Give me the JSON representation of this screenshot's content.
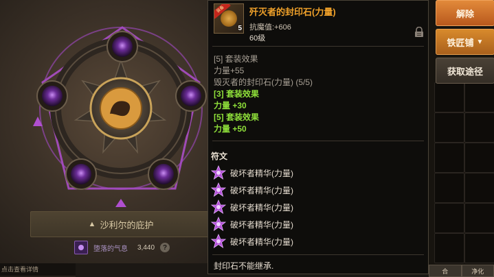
{
  "item": {
    "title": "歼灭者的封印石(力量)",
    "tag": "装备",
    "count": "5",
    "stat": "抗魔值:+606",
    "level": "60级"
  },
  "set_effects": [
    {
      "text": "[5] 套装效果",
      "style": "grey"
    },
    {
      "text": "力量+55",
      "style": "grey"
    },
    {
      "text": "毁灭者的封印石(力量) (5/5)",
      "style": "grey"
    },
    {
      "text": "[3] 套装效果",
      "style": "green"
    },
    {
      "text": "力量 +30",
      "style": "green"
    },
    {
      "text": "[5] 套装效果",
      "style": "green"
    },
    {
      "text": "力量 +50",
      "style": "green"
    }
  ],
  "runes": {
    "header": "符文",
    "items": [
      "破坏者精华(力量)",
      "破坏者精华(力量)",
      "破坏者精华(力量)",
      "破坏者精华(力量)",
      "破坏者精华(力量)"
    ]
  },
  "footer_note": "封印石不能继承.",
  "buttons": {
    "dismantle": "解除",
    "blacksmith": "铁匠铺",
    "obtain": "获取途径"
  },
  "bottom_right": [
    "合",
    "净化"
  ],
  "left": {
    "blessing": "沙利尔的庇护",
    "aura_name": "堕落的气息",
    "aura_value": "3,440",
    "help": "?",
    "bottom_text": "点击查看详情"
  },
  "colors": {
    "title_orange": "#f0a12a",
    "set_green": "#8fe03a",
    "rune_purple": "#b34fd8",
    "button_orange": "#d98a34"
  }
}
